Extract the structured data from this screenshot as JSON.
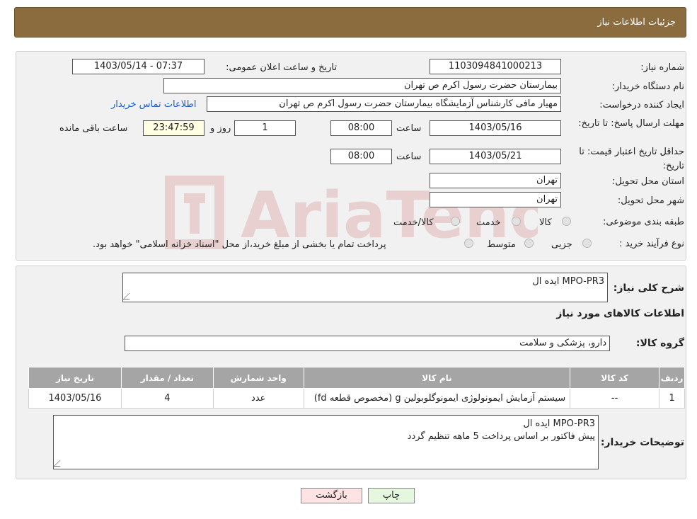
{
  "header": {
    "title": "جزئیات اطلاعات نیاز"
  },
  "form": {
    "need_number_label": "شماره نیاز:",
    "need_number": "1103094841000213",
    "announce_label": "تاریخ و ساعت اعلان عمومی:",
    "announce_value": "1403/05/14 - 07:37",
    "buyer_org_label": "نام دستگاه خریدار:",
    "buyer_org": "بیمارستان حضرت رسول اکرم ص  تهران",
    "requester_label": "ایجاد کننده درخواست:",
    "requester": "مهیار مافی کارشناس آزمایشگاه بیمارستان حضرت رسول اکرم ص  تهران",
    "contact_link": "اطلاعات تماس خریدار",
    "deadline_label": "مهلت ارسال پاسخ: تا تاریخ:",
    "deadline_date": "1403/05/16",
    "hour_label": "ساعت",
    "deadline_time": "08:00",
    "days_value": "1",
    "days_label": "روز و",
    "remaining_time": "23:47:59",
    "remaining_label": "ساعت باقی مانده",
    "validity_label": "حداقل تاریخ اعتبار قیمت: تا تاریخ:",
    "validity_date": "1403/05/21",
    "validity_time": "08:00",
    "province_label": "استان محل تحویل:",
    "province": "تهران",
    "city_label": "شهر محل تحویل:",
    "city": "تهران",
    "category_label": "طبقه بندی موضوعی:",
    "category_options": [
      "کالا",
      "خدمت",
      "کالا/خدمت"
    ],
    "process_label": "نوع فرآیند خرید :",
    "process_options": [
      "جزیی",
      "متوسط"
    ],
    "process_note": "پرداخت تمام یا بخشی از مبلغ خرید،از محل \"اسناد خزانه اسلامی\" خواهد بود."
  },
  "details": {
    "summary_label": "شرح کلی نیاز:",
    "summary": "MPO-PR3 ایده ال",
    "goods_title": "اطلاعات کالاهای مورد نیاز",
    "group_label": "گروه کالا:",
    "group": "دارو، پزشکی و سلامت",
    "table": {
      "headers": [
        "ردیف",
        "کد کالا",
        "نام کالا",
        "واحد شمارش",
        "تعداد / مقدار",
        "تاریخ نیاز"
      ],
      "rows": [
        [
          "1",
          "--",
          "سیستم آزمایش ایمونولوژی ایمونوگلوبولین g (مخصوص قطعه fd)",
          "عدد",
          "4",
          "1403/05/16"
        ]
      ]
    },
    "buyer_notes_label": "توضیحات خریدار:",
    "buyer_notes_line1": "MPO-PR3 ایده ال",
    "buyer_notes_line2": "پیش فاکتور بر اساس پرداخت 5 ماهه تنظیم گردد"
  },
  "buttons": {
    "print": "چاپ",
    "back": "بازگشت"
  },
  "colors": {
    "header_bg": "#8b6c3f",
    "table_header_bg": "#a5a5a5",
    "back_button_bg": "#fde3e3",
    "print_button_bg": "#e6f7e0"
  }
}
